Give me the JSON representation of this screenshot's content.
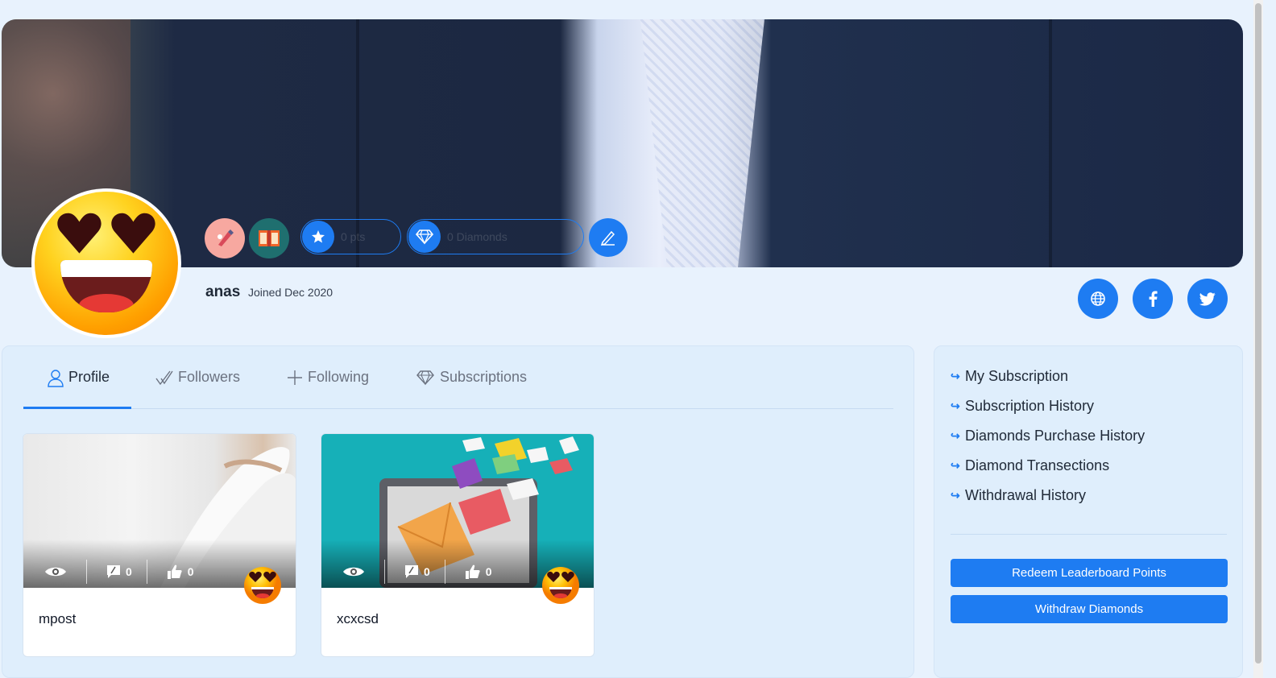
{
  "profile": {
    "username": "anas",
    "joined": "Joined Dec 2020",
    "points_pill_text": "0 pts",
    "diamonds_pill_text": "0 Diamonds"
  },
  "badges": [
    {
      "name": "writer-badge-icon",
      "bg": "#f7a8a0"
    },
    {
      "name": "book-badge-icon",
      "bg": "#1f6f6f"
    }
  ],
  "social": [
    "website-icon",
    "facebook-icon",
    "twitter-icon"
  ],
  "tabs": [
    {
      "label": "Profile",
      "active": true
    },
    {
      "label": "Followers",
      "active": false
    },
    {
      "label": "Following",
      "active": false
    },
    {
      "label": "Subscriptions",
      "active": false
    }
  ],
  "posts": [
    {
      "title": "mpost",
      "views": "",
      "comments": "0",
      "likes": "0"
    },
    {
      "title": "xcxcsd",
      "views": "",
      "comments": "0",
      "likes": "0"
    }
  ],
  "sidebar": {
    "links": [
      "My Subscription",
      "Subscription History",
      "Diamonds Purchase History",
      "Diamond Transections",
      "Withdrawal History"
    ],
    "redeem_button": "Redeem Leaderboard Points",
    "withdraw_button": "Withdraw Diamonds"
  },
  "colors": {
    "accent": "#1e7cf2",
    "page_bg": "#e8f2fd",
    "panel_bg": "#dfeefc"
  }
}
